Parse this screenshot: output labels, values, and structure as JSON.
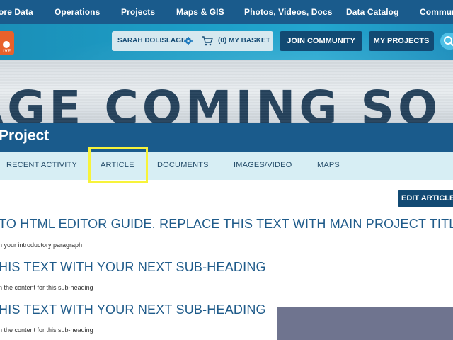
{
  "topnav": {
    "items": [
      "ore Data",
      "Operations",
      "Projects",
      "Maps & GIS",
      "Photos, Videos, Docs",
      "Data Catalog",
      "Commun"
    ]
  },
  "header": {
    "logo_text": "IVE",
    "user_name": "SARAH DOLISLAGER",
    "basket_label": "(0) MY BASKET",
    "join_label": "JOIN COMMUNITY",
    "my_projects_label": "MY PROJECTS",
    "icons": {
      "gear": "gear-icon",
      "basket": "basket-icon",
      "search": "search-icon"
    }
  },
  "banner": {
    "text": "AGE COMING SO"
  },
  "project": {
    "title": "Project"
  },
  "tabs": [
    {
      "label": "RECENT ACTIVITY"
    },
    {
      "label": "ARTICLE"
    },
    {
      "label": "DOCUMENTS"
    },
    {
      "label": "IMAGES/VIDEO"
    },
    {
      "label": "MAPS"
    }
  ],
  "content": {
    "edit_label": "EDIT ARTICLE",
    "main_heading": "TO HTML EDITOR GUIDE. REPLACE THIS TEXT WITH MAIN PROJECT TITLE",
    "intro": "n your introductory paragraph",
    "sub1_heading": "HIS TEXT WITH YOUR NEXT SUB-HEADING",
    "sub1_text": "n the content for this sub-heading",
    "sub2_heading": "HIS TEXT WITH YOUR NEXT SUB-HEADING",
    "sub2_text": "n the content for this sub-heading"
  },
  "colors": {
    "nav": "#1a5b8c",
    "accent_button": "#124a73",
    "tab_bg": "#d7eef4",
    "highlight": "#f7f33a",
    "heading": "#1f5b8a"
  }
}
